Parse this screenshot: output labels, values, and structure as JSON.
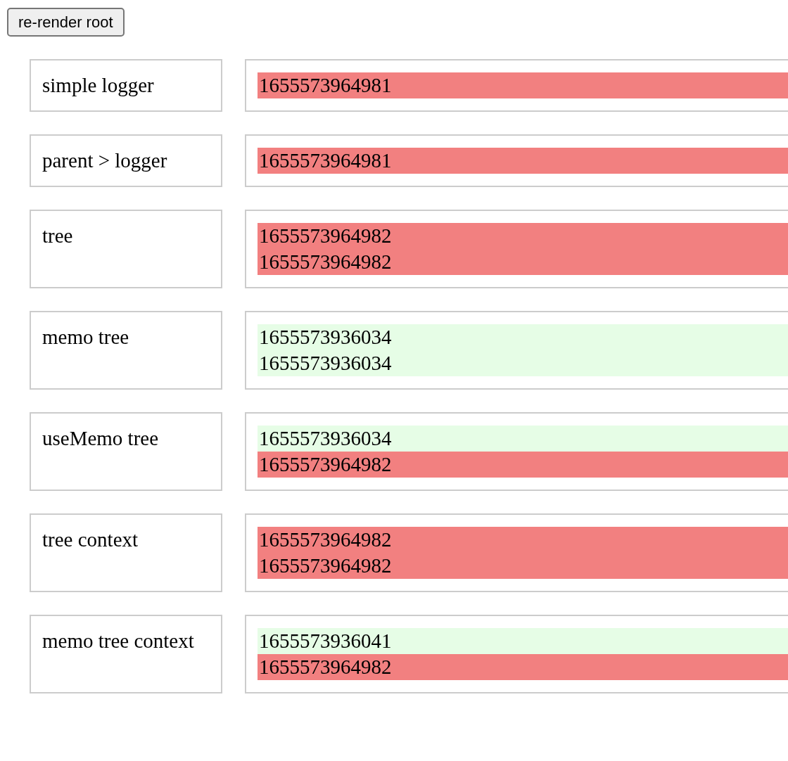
{
  "button": {
    "label": "re-render root"
  },
  "rows": [
    {
      "label": "simple logger",
      "lines": [
        {
          "text": "1655573964981",
          "color": "#f28080"
        }
      ]
    },
    {
      "label": "parent > logger",
      "lines": [
        {
          "text": "1655573964981",
          "color": "#f28080"
        }
      ]
    },
    {
      "label": "tree",
      "lines": [
        {
          "text": "1655573964982",
          "color": "#f28080"
        },
        {
          "text": "1655573964982",
          "color": "#f28080"
        }
      ]
    },
    {
      "label": "memo tree",
      "lines": [
        {
          "text": "1655573936034",
          "color": "#e6fde6"
        },
        {
          "text": "1655573936034",
          "color": "#e6fde6"
        }
      ]
    },
    {
      "label": "useMemo tree",
      "lines": [
        {
          "text": "1655573936034",
          "color": "#e6fde6"
        },
        {
          "text": "1655573964982",
          "color": "#f28080"
        }
      ]
    },
    {
      "label": "tree context",
      "lines": [
        {
          "text": "1655573964982",
          "color": "#f28080"
        },
        {
          "text": "1655573964982",
          "color": "#f28080"
        }
      ]
    },
    {
      "label": "memo tree context",
      "lines": [
        {
          "text": "1655573936041",
          "color": "#e6fde6"
        },
        {
          "text": "1655573964982",
          "color": "#f28080"
        }
      ]
    }
  ]
}
